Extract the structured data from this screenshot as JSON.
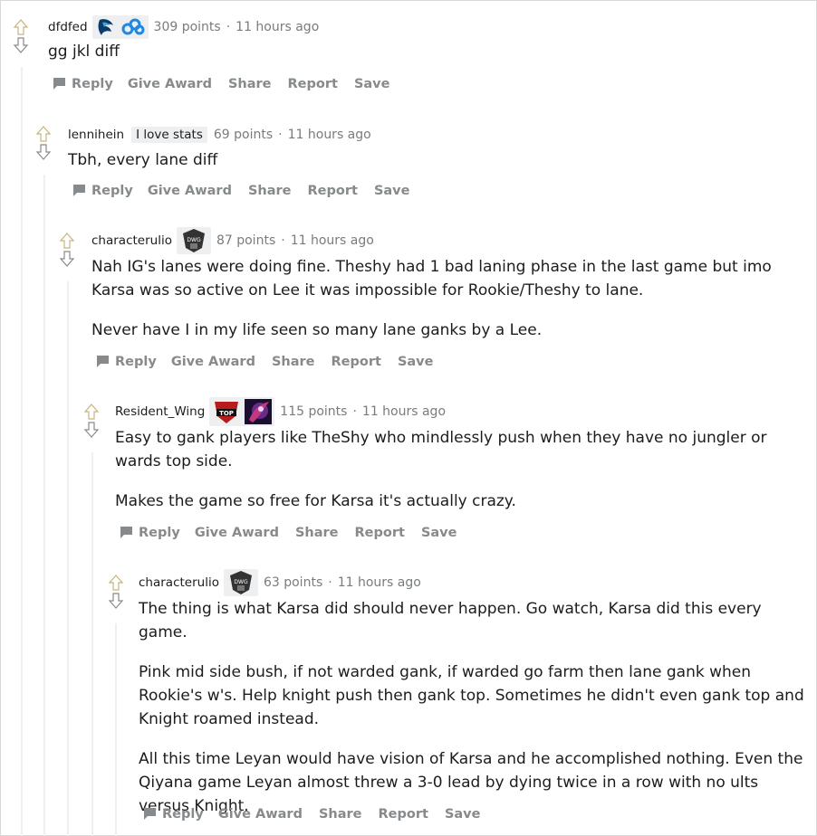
{
  "comments": [
    {
      "author": "dfdfed",
      "flair_icons": [
        "liquid-team-logo",
        "cloud9-team-logo"
      ],
      "points": "309 points",
      "sep": "·",
      "time": "11 hours ago",
      "paragraphs": [
        "gg jkl diff"
      ]
    },
    {
      "author": "lennihein",
      "flair_text": "I love stats",
      "points": "69 points",
      "sep": "·",
      "time": "11 hours ago",
      "paragraphs": [
        "Tbh, every lane diff"
      ]
    },
    {
      "author": "characterulio",
      "flair_icons": [
        "dwg-team-logo"
      ],
      "points": "87 points",
      "sep": "·",
      "time": "11 hours ago",
      "paragraphs": [
        "Nah IG's lanes were doing fine. Theshy had 1 bad laning phase in the last game but imo Karsa was so active on Lee it was impossible for Rookie/Theshy to lane.",
        "Never have I in my life seen so many lane ganks by a Lee."
      ]
    },
    {
      "author": "Resident_Wing",
      "flair_icons": [
        "top-esports-logo",
        "champion-portrait"
      ],
      "points": "115 points",
      "sep": "·",
      "time": "11 hours ago",
      "paragraphs": [
        "Easy to gank players like TheShy who mindlessly push when they have no jungler or wards top side.",
        "Makes the game so free for Karsa it's actually crazy."
      ]
    },
    {
      "author": "characterulio",
      "flair_icons": [
        "dwg-team-logo"
      ],
      "points": "63 points",
      "sep": "·",
      "time": "11 hours ago",
      "paragraphs": [
        "The thing is what Karsa did should never happen. Go watch, Karsa did this every game.",
        "Pink mid side bush, if not warded gank, if warded go farm then lane gank when Rookie's w's. Help knight push then gank top. Sometimes he didn't even gank top and Knight roamed instead.",
        "All this time Leyan would have vision of Karsa and he accomplished nothing. Even the Qiyana game Leyan almost threw a 3-0 lead by dying twice in a row with no ults versus Knight."
      ]
    }
  ],
  "actions": {
    "reply": "Reply",
    "give_award": "Give Award",
    "share": "Share",
    "report": "Report",
    "save": "Save"
  },
  "colors": {
    "upvote_arrow": "#c9b37e",
    "downvote_arrow": "#878a8c",
    "thread_line": "#edeff1",
    "meta_text": "#787c7e",
    "action_text": "#878a8c"
  }
}
